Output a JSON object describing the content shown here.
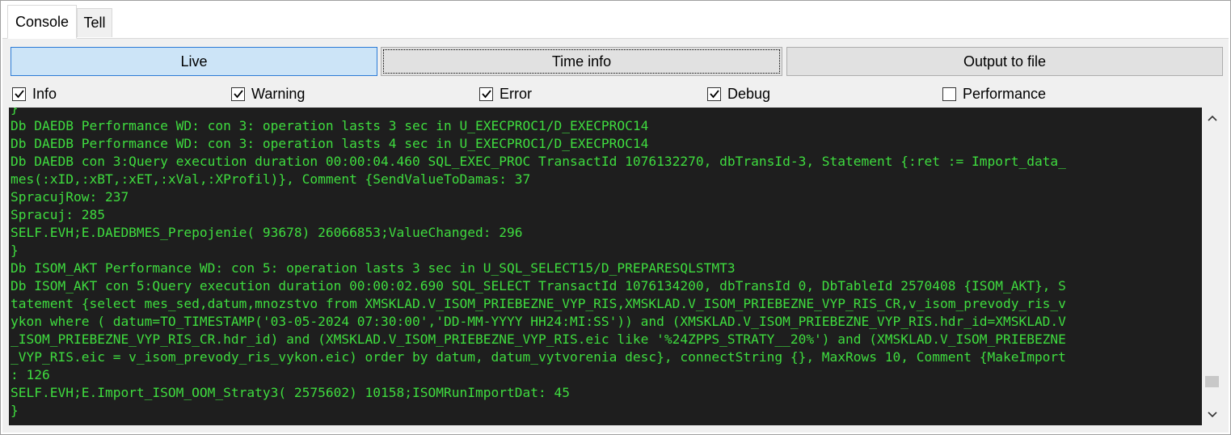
{
  "tabs": [
    {
      "label": "Console"
    },
    {
      "label": "Tell"
    }
  ],
  "toolbar": {
    "live_label": "Live",
    "time_info_label": "Time info",
    "output_label": "Output to file"
  },
  "filters": [
    {
      "label": "Info",
      "checked": true
    },
    {
      "label": "Warning",
      "checked": true
    },
    {
      "label": "Error",
      "checked": true
    },
    {
      "label": "Debug",
      "checked": true
    },
    {
      "label": "Performance",
      "checked": false
    }
  ],
  "console": {
    "text_color": "#3fdc3f",
    "background": "#1e1e1e",
    "lines": [
      "}",
      "Db DAEDB Performance WD: con 3: operation lasts 3 sec in U_EXECPROC1/D_EXECPROC14",
      "Db DAEDB Performance WD: con 3: operation lasts 4 sec in U_EXECPROC1/D_EXECPROC14",
      "Db DAEDB con 3:Query execution duration 00:00:04.460 SQL_EXEC_PROC TransactId 1076132270, dbTransId-3, Statement {:ret := Import_data_",
      "mes(:xID,:xBT,:xET,:xVal,:XProfil)}, Comment {SendValueToDamas: 37",
      "SpracujRow: 237",
      "Spracuj: 285",
      "SELF.EVH;E.DAEDBMES_Prepojenie( 93678) 26066853;ValueChanged: 296",
      "}",
      "Db ISOM_AKT Performance WD: con 5: operation lasts 3 sec in U_SQL_SELECT15/D_PREPARESQLSTMT3",
      "Db ISOM_AKT con 5:Query execution duration 00:00:02.690 SQL_SELECT TransactId 1076134200, dbTransId 0, DbTableId 2570408 {ISOM_AKT}, S",
      "tatement {select mes_sed,datum,mnozstvo from XMSKLAD.V_ISOM_PRIEBEZNE_VYP_RIS,XMSKLAD.V_ISOM_PRIEBEZNE_VYP_RIS_CR,v_isom_prevody_ris_v",
      "ykon where ( datum=TO_TIMESTAMP('03-05-2024 07:30:00','DD-MM-YYYY HH24:MI:SS')) and (XMSKLAD.V_ISOM_PRIEBEZNE_VYP_RIS.hdr_id=XMSKLAD.V",
      "_ISOM_PRIEBEZNE_VYP_RIS_CR.hdr_id) and (XMSKLAD.V_ISOM_PRIEBEZNE_VYP_RIS.eic like '%24ZPPS_STRATY__20%') and (XMSKLAD.V_ISOM_PRIEBEZNE",
      "_VYP_RIS.eic = v_isom_prevody_ris_vykon.eic) order by datum, datum_vytvorenia desc}, connectString {}, MaxRows 10, Comment {MakeImport",
      ": 126",
      "SELF.EVH;E.Import_ISOM_OOM_Straty3( 2575602) 10158;ISOMRunImportDat: 45",
      "}"
    ]
  },
  "scrollbar": {
    "position_fraction": 0.93
  }
}
